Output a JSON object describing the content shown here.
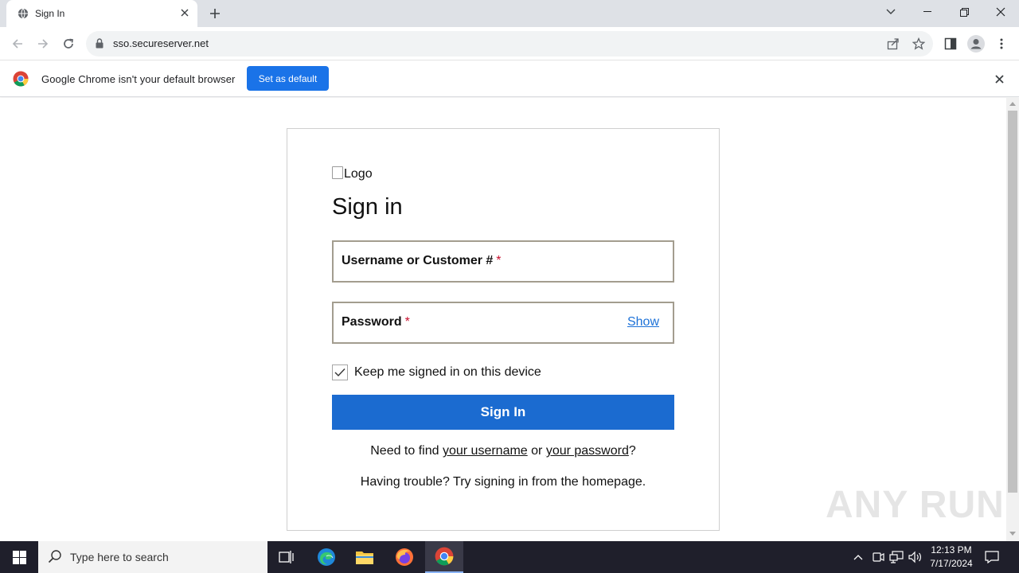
{
  "browser": {
    "tab_title": "Sign In",
    "url": "sso.secureserver.net"
  },
  "infobar": {
    "message": "Google Chrome isn't your default browser",
    "button_label": "Set as default"
  },
  "page": {
    "logo_alt": "Logo",
    "heading": "Sign in",
    "username_label": "Username or Customer #",
    "password_label": "Password",
    "required_mark": "*",
    "show_label": "Show",
    "remember_label": "Keep me signed in on this device",
    "remember_checked": true,
    "signin_button": "Sign In",
    "find_prefix": "Need to find ",
    "find_username_link": "your username",
    "find_or": " or ",
    "find_password_link": "your password",
    "find_suffix": "?",
    "trouble_text": "Having trouble? Try signing in from the homepage."
  },
  "watermark": "ANY RUN",
  "taskbar": {
    "search_placeholder": "Type here to search",
    "time": "12:13 PM",
    "date": "7/17/2024"
  },
  "colors": {
    "primary_button": "#1b6bd0",
    "chrome_button": "#1a73e8",
    "field_border": "#a39d8f",
    "required": "#c8102e",
    "link": "#1d72d8"
  }
}
